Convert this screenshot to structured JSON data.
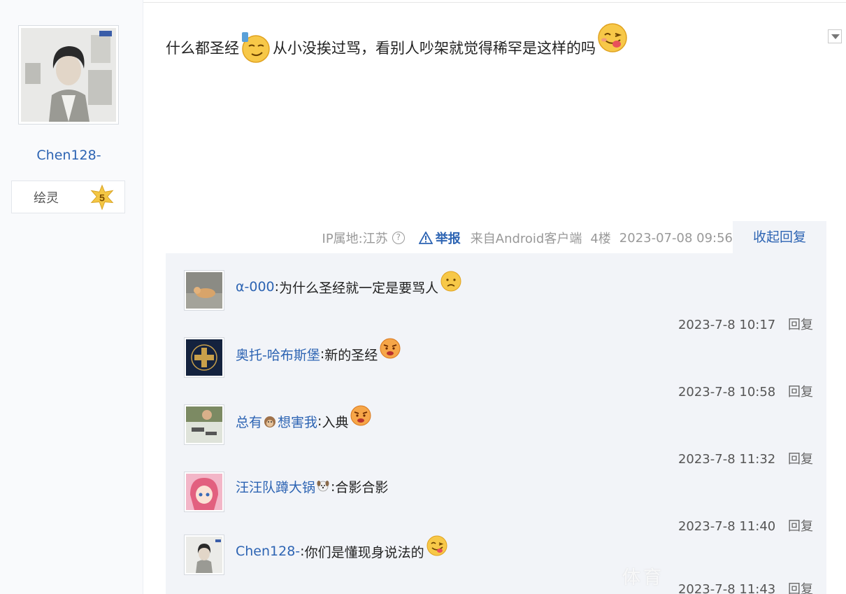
{
  "author": {
    "name": "Chen128-",
    "level_title": "绘灵",
    "level_number": "5"
  },
  "post": {
    "text_part1": "什么都圣经",
    "text_part2": "从小没挨过骂，看别人吵架就觉得稀罕是这样的吗",
    "emoji1": "smug-emoji",
    "emoji2": "tongue-out-emoji"
  },
  "meta": {
    "ip": "IP属地:江苏",
    "help": "?",
    "report": "举报",
    "client": "来自Android客户端",
    "floor": "4楼",
    "datetime": "2023-07-08 09:56",
    "collapse": "收起回复"
  },
  "replies": [
    {
      "user": "α-000",
      "sep": ": ",
      "text": "为什么圣经就一定是要骂人",
      "emoji": "worried-emoji",
      "time": "2023-7-8 10:17",
      "reply_label": "回复"
    },
    {
      "user": "奥托-哈布斯堡",
      "sep": ": ",
      "text": "新的圣经",
      "emoji": "angry-emoji",
      "time": "2023-7-8 10:58",
      "reply_label": "回复"
    },
    {
      "user_part1": "总有",
      "user_part2": "想害我",
      "sep": ": ",
      "text": "入典",
      "emoji": "angry-emoji",
      "time": "2023-7-8 11:32",
      "reply_label": "回复"
    },
    {
      "user": "汪汪队蹲大锅",
      "sep": ": ",
      "text": "合影合影",
      "time": "2023-7-8 11:40",
      "reply_label": "回复"
    },
    {
      "user": "Chen128-",
      "sep": ": ",
      "text": "你们是懂现身说法的",
      "emoji": "tongue-out-emoji",
      "time": "2023-7-8 11:43",
      "reply_label": "回复"
    }
  ],
  "watermark": "体育"
}
